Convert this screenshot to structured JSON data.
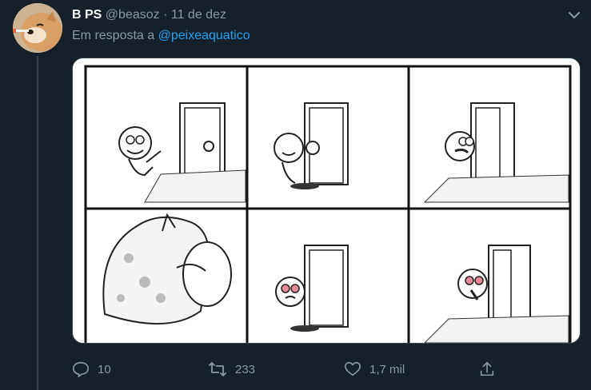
{
  "tweet": {
    "author_name": "B PS",
    "author_handle": "@beasoz",
    "separator": "·",
    "date": "11 de dez",
    "reply_prefix": "Em resposta a",
    "reply_mention": "@peixeaquatico",
    "media_description": "Six-panel black-and-white comic strip",
    "actions": {
      "reply_count": "10",
      "retweet_count": "233",
      "like_count": "1,7 mil"
    }
  },
  "colors": {
    "background": "#15202b",
    "text_secondary": "#8899a6",
    "link": "#1da1f2",
    "thread_line": "#38444d"
  },
  "icons": {
    "menu": "chevron-down-icon",
    "reply": "reply-icon",
    "retweet": "retweet-icon",
    "like": "heart-icon",
    "share": "share-icon"
  }
}
